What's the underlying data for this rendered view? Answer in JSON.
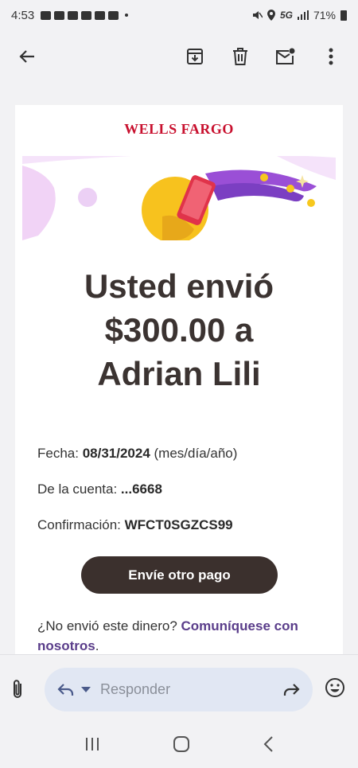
{
  "status": {
    "time": "4:53",
    "network": "5G",
    "battery": "71%"
  },
  "toolbar": {
    "back_icon": "arrow-left-icon",
    "archive_icon": "archive-icon",
    "delete_icon": "trash-icon",
    "mark_unread_icon": "mail-unread-icon",
    "more_icon": "more-vert-icon"
  },
  "email": {
    "brand": "WELLS FARGO",
    "headline": [
      "Usted envió",
      "$300.00 a",
      "Adrian Lili"
    ],
    "date_label": "Fecha: ",
    "date_value": "08/31/2024",
    "date_suffix": " (mes/día/año)",
    "account_label": "De la cuenta: ",
    "account_value": "...6668",
    "confirmation_label": "Confirmación: ",
    "confirmation_value": "WFCT0SGZCS99",
    "button_label": "Envíe otro pago",
    "question_text": "¿No envió este dinero? ",
    "contact_link": "Comuníquese con nosotros",
    "question_end": "."
  },
  "reply": {
    "placeholder": "Responder"
  },
  "colors": {
    "brand_red": "#c8102e",
    "button_bg": "#3b302d",
    "link_purple": "#5a3d8a"
  }
}
